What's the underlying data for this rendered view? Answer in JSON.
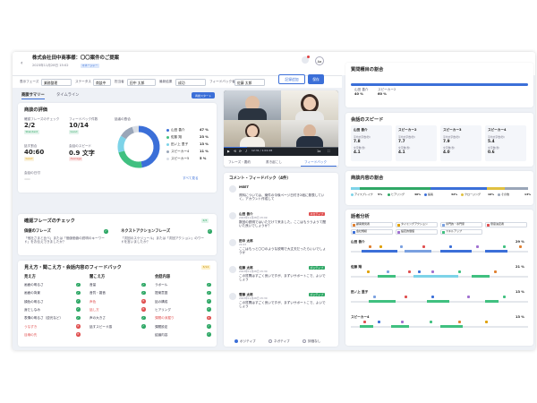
{
  "header": {
    "title": "株式会社田中商事様：〇〇案件のご提案",
    "date": "2023年11月28日 15:02",
    "badge": "マネージャー",
    "avatar": "Aa",
    "share_btn": "記録追加",
    "save_btn": "保存"
  },
  "filters": [
    {
      "label": "表示フェーズ",
      "value": "業務整理"
    },
    {
      "label": "ステータス",
      "value": "商談中"
    },
    {
      "label": "担当者",
      "value": "田中 太郎"
    },
    {
      "label": "最新結果",
      "value": "成功"
    },
    {
      "label": "フィードバック者",
      "value": "佐藤 太郎"
    }
  ],
  "tabs": {
    "summary": "商談サマリー",
    "timeline": "タイムライン",
    "export": "商談スタート"
  },
  "eval": {
    "title": "商談の評価",
    "metrics": [
      {
        "label": "確認フレーズのチェック",
        "value": "2/2",
        "badge": "Standard",
        "color": "#2fa866"
      },
      {
        "label": "フィードバック件数",
        "value": "10/14",
        "badge": "Good",
        "color": "#2fa866"
      },
      {
        "label": "話す割合",
        "value": "40:60",
        "badge": "Good",
        "color": "#e0a000"
      },
      {
        "label": "会話のスピード",
        "value": "0.9 文字",
        "badge": "Average",
        "color": "#e05050"
      }
    ],
    "donut_label": "話者の割合",
    "legend": [
      {
        "name": "山田 善介",
        "pct": "47 %",
        "color": "#3b6fd8"
      },
      {
        "name": "佐藤 翔",
        "pct": "23 %",
        "color": "#40c080"
      },
      {
        "name": "田ノ上 里子",
        "pct": "13 %",
        "color": "#7dd3e8"
      },
      {
        "name": "スピーカー4",
        "pct": "11 %",
        "color": "#9aa6b8"
      },
      {
        "name": "スピーカー5",
        "pct": "5 %",
        "color": "#d8dde5"
      }
    ],
    "see_all": "すべて見る",
    "shares": [
      47,
      23,
      13,
      11,
      5
    ],
    "sub": "会話の日付"
  },
  "phrases": {
    "title": "確認フレーズのチェック",
    "badge": "2/2",
    "left": {
      "title": "価値のフレーズ",
      "text": "「他社さまと比べ」または「価値価値の説明のキーワード」をお伝えできましたか？"
    },
    "right": {
      "title": "ネクストアクションフレーズ",
      "text": "「次回のスケジュール」または「次回アクション」のワードを言いましたか？"
    }
  },
  "listen": {
    "title": "見え方・聞こえ方・会話内容のフィードバック",
    "badge": "3/14",
    "cols": [
      {
        "title": "見え方",
        "items": [
          "画面の明るさ",
          "画面の背景",
          "顔色の明るさ",
          "身だしなみ",
          "表情の明るさ（逆光など）",
          "うなずき",
          "目線の先"
        ],
        "ok": [
          true,
          true,
          true,
          true,
          true,
          false,
          false
        ]
      },
      {
        "title": "聞こえ方",
        "items": [
          "音量",
          "音質・雑音",
          "声色",
          "話し方",
          "声の大きさ",
          "話すスピード感"
        ],
        "ok": [
          true,
          true,
          false,
          false,
          true,
          true
        ]
      },
      {
        "title": "会話内容",
        "items": [
          "ラポール",
          "提案意図",
          "話の構成",
          "ヒアリング",
          "課題の深掘り",
          "課題設定",
          "結論内容"
        ],
        "ok": [
          true,
          true,
          true,
          true,
          false,
          true,
          true
        ]
      }
    ]
  },
  "video": {
    "time": "12:31 / 1:01:28",
    "tabs": [
      "フレーズ・要約",
      "書き起こし",
      "フィードバック"
    ]
  },
  "comments": {
    "title": "コメント・フィードバック（4件）",
    "items": [
      {
        "author": "MEET",
        "text": "資料については、案件の今後ページ日付き2紙に発表していく。アカウント作成して",
        "tag": "",
        "sub": ""
      },
      {
        "author": "山田 善介",
        "text": "数回の説明ではいただけて来ました。ここはもううようて聞いた良いでしょうか？",
        "tag": "ネガティブ",
        "tagc": "#e05050",
        "date": "2023年11月28日 15:09"
      },
      {
        "author": "田中 太郎",
        "text": "ここはもっと〇〇のような説明で大丈夫だったらいいでしょうか",
        "tag": "",
        "sub": "21:03"
      },
      {
        "author": "佐藤 太郎",
        "text": "この質問はすごく良いですが、まずいサポートこで、よいでしょう",
        "tag": "ポジティブ",
        "tagc": "#2fa866",
        "date": "2023年11月28日 15:30"
      },
      {
        "author": "菅藤 太郎",
        "text": "この質問はすごく良いですが、まずいサポートこで、よいでしょう",
        "tag": "ポジティブ",
        "tagc": "#2fa866",
        "date": "2023年11月28日 15:30"
      }
    ],
    "radios": [
      "ポジティブ",
      "ネガティブ",
      "評価なし"
    ]
  },
  "right1": {
    "title": "質問種目の割合",
    "rows": [
      {
        "name": "山田 善介",
        "pct": "40 %",
        "val": 40
      },
      {
        "name": "スピーカー2",
        "pct": "60 %",
        "val": 60
      }
    ],
    "marker": "60 %"
  },
  "right2": {
    "title": "会話のスピード",
    "speakers": [
      {
        "name": "山田 善介",
        "v1": "平均文字数(秒)",
        "v2": "7.8",
        "v3": "文字数(秒)",
        "v4": "4.1"
      },
      {
        "name": "スピーカー2",
        "v1": "平均文字数(秒)",
        "v2": "7.7",
        "v3": "文字数(秒)",
        "v4": "4.1"
      },
      {
        "name": "スピーカー3",
        "v1": "平均文字数(秒)",
        "v2": "7.9",
        "v3": "文字数(秒)",
        "v4": "4.0"
      },
      {
        "name": "スピーカー4",
        "v1": "平均文字数(秒)",
        "v2": "5.4",
        "v3": "文字数(秒)",
        "v4": "0.6"
      }
    ]
  },
  "right3": {
    "title": "商談内容の割合",
    "labels": [
      {
        "name": "アイスブレイク",
        "pct": "5%",
        "color": "#7dd3e8"
      },
      {
        "name": "ヒアリング",
        "pct": "40%",
        "color": "#2fa866"
      },
      {
        "name": "提案",
        "pct": "32%",
        "color": "#3b6fd8"
      },
      {
        "name": "クロージング",
        "pct": "10%",
        "color": "#e0c040"
      },
      {
        "name": "その他",
        "pct": "13%",
        "color": "#9aa6b8"
      }
    ],
    "segments": [
      5,
      40,
      32,
      10,
      13
    ]
  },
  "right4": {
    "title": "話者分析",
    "tags": [
      {
        "name": "顧客発見者",
        "color": "#e08030"
      },
      {
        "name": "タイミングアクション",
        "color": "#e0a000"
      },
      {
        "name": "専門的・専門家",
        "color": "#7aa0e0"
      },
      {
        "name": "意思決定者",
        "color": "#e05050"
      },
      {
        "name": "会社規模",
        "color": "#3b6fd8"
      },
      {
        "name": "設定的価値",
        "color": "#a070d0"
      },
      {
        "name": "スキルアップ",
        "color": "#40c080"
      }
    ],
    "tracks": [
      {
        "name": "山田 善介",
        "pct": "29 %"
      },
      {
        "name": "佐藤 翔",
        "pct": "21 %"
      },
      {
        "name": "田ノ上 里子",
        "pct": "13 %"
      },
      {
        "name": "スピーカー4",
        "pct": "13 %"
      }
    ]
  }
}
